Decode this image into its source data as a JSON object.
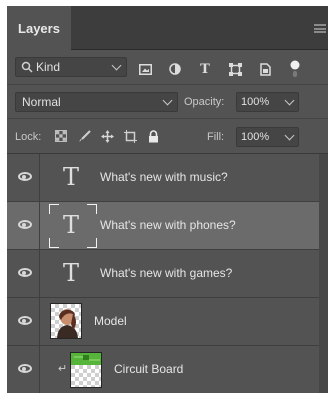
{
  "panel": {
    "tab_label": "Layers"
  },
  "filter": {
    "kind_label": "Kind",
    "icons": [
      "image-filter-icon",
      "adjustment-filter-icon",
      "type-filter-icon",
      "shape-filter-icon",
      "smart-object-filter-icon",
      "filter-toggle-icon"
    ]
  },
  "blend": {
    "mode": "Normal",
    "opacity_label": "Opacity:",
    "opacity_value": "100%"
  },
  "lock": {
    "label": "Lock:",
    "icons": [
      "lock-transparent-pixels-icon",
      "lock-image-pixels-icon",
      "lock-position-icon",
      "lock-artboard-icon",
      "lock-all-icon"
    ],
    "fill_label": "Fill:",
    "fill_value": "100%"
  },
  "layers": [
    {
      "name": "What's new with music?",
      "type": "text",
      "visible": true,
      "selected": false
    },
    {
      "name": "What's new with phones?",
      "type": "text",
      "visible": true,
      "selected": true
    },
    {
      "name": "What's new with games?",
      "type": "text",
      "visible": true,
      "selected": false
    },
    {
      "name": "Model",
      "type": "image",
      "visible": true,
      "selected": false
    },
    {
      "name": "Circuit Board",
      "type": "image",
      "visible": true,
      "selected": false,
      "clipped": true
    }
  ],
  "colors": {
    "panel_bg": "#535353",
    "header_bg": "#3d3d3d",
    "selected_row": "#6b6b6b",
    "circuit_green": "#57b43a"
  }
}
